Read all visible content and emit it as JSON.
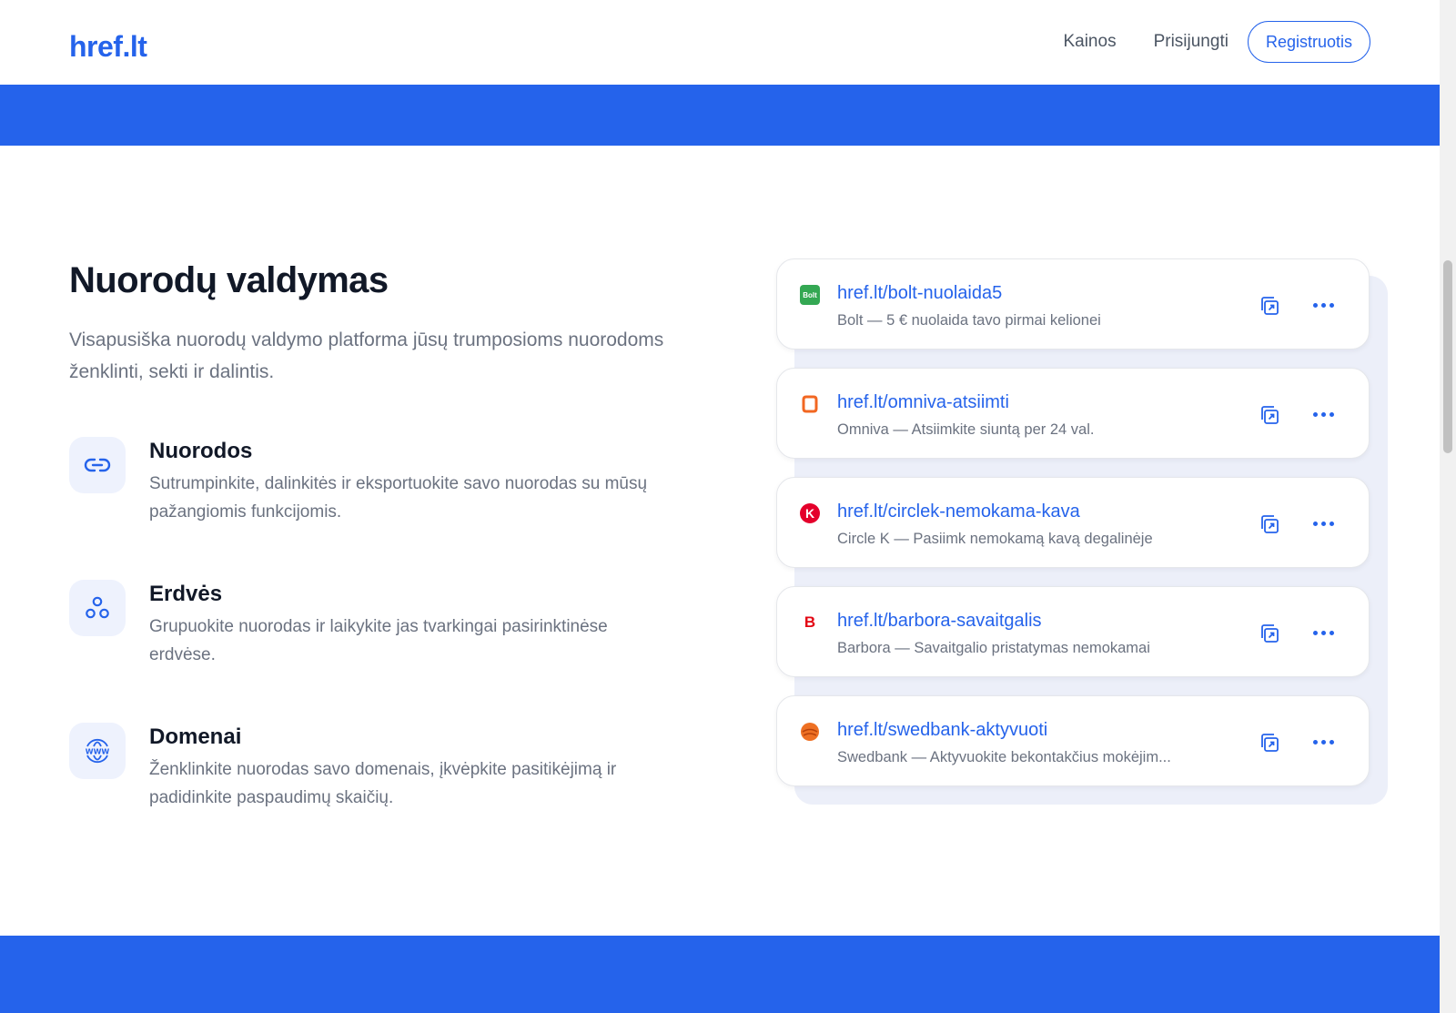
{
  "header": {
    "logo": "href.lt",
    "nav": {
      "pricing": "Kainos",
      "login": "Prisijungti",
      "register": "Registruotis"
    }
  },
  "section": {
    "title": "Nuorodų valdymas",
    "description": "Visapusiška nuorodų valdymo platforma jūsų trumposioms nuorodoms ženklinti, sekti ir dalintis."
  },
  "features": [
    {
      "icon": "link-icon",
      "title": "Nuorodos",
      "text": "Sutrumpinkite, dalinkitės ir eksportuokite savo nuorodas su mūsų pažangiomis funkcijomis."
    },
    {
      "icon": "spaces-icon",
      "title": "Erdvės",
      "text": "Grupuokite nuorodas ir laikykite jas tvarkingai pasirinktinėse erdvėse."
    },
    {
      "icon": "www-globe-icon",
      "title": "Domenai",
      "text": "Ženklinkite nuorodas savo domenais, įkvėpkite pasitikėjimą ir padidinkite paspaudimų skaičių."
    }
  ],
  "links": [
    {
      "favicon": "bolt-favicon",
      "favicon_text": "Bolt",
      "url": "href.lt/bolt-nuolaida5",
      "description": "Bolt — 5 € nuolaida tavo pirmai kelionei"
    },
    {
      "favicon": "omniva-favicon",
      "favicon_text": "",
      "url": "href.lt/omniva-atsiimti",
      "description": "Omniva — Atsiimkite siuntą per 24 val."
    },
    {
      "favicon": "circlek-favicon",
      "favicon_text": "K",
      "url": "href.lt/circlek-nemokama-kava",
      "description": "Circle K — Pasiimk nemokamą kavą degalinėje"
    },
    {
      "favicon": "barbora-favicon",
      "favicon_text": "B",
      "url": "href.lt/barbora-savaitgalis",
      "description": "Barbora — Savaitgalio pristatymas nemokamai"
    },
    {
      "favicon": "swedbank-favicon",
      "favicon_text": "",
      "url": "href.lt/swedbank-aktyvuoti",
      "description": "Swedbank — Aktyvuokite bekontakčius mokėjim..."
    }
  ],
  "colors": {
    "brand": "#2563eb",
    "bolt": "#34a853",
    "omniva": "#f26722",
    "circlek": "#e4002b",
    "barbora": "#e30613",
    "swedbank": "#ee7023"
  }
}
